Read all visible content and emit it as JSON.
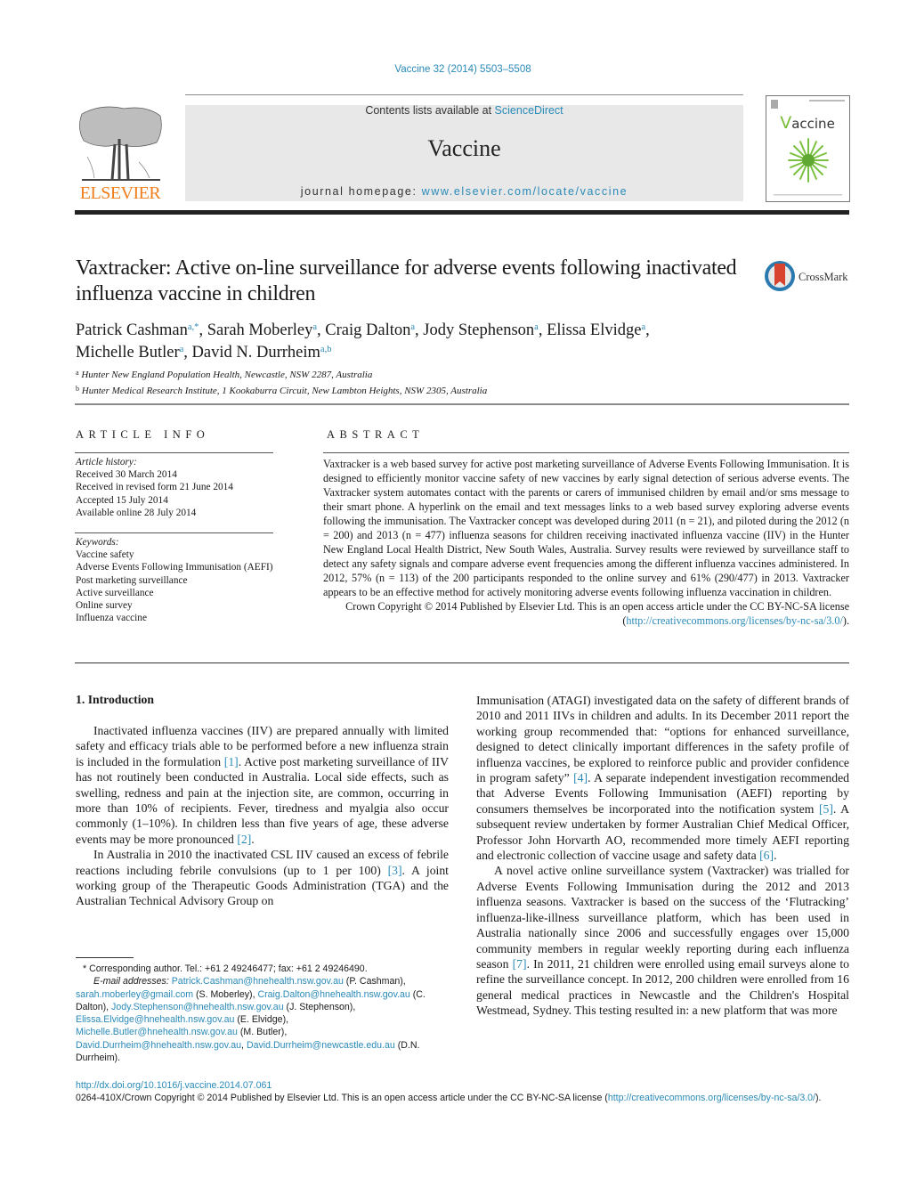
{
  "header": {
    "journal_ref": "Vaccine 32 (2014) 5503–5508",
    "contents_prefix": "Contents lists available at ",
    "contents_link": "ScienceDirect",
    "journal_title": "Vaccine",
    "homepage_prefix": "journal homepage: ",
    "homepage_link": "www.elsevier.com/locate/vaccine",
    "publisher_logo_text": "ELSEVIER",
    "cover_title": "Vaccine",
    "crossmark_label": "CrossMark"
  },
  "article": {
    "title": "Vaxtracker: Active on-line surveillance for adverse events following inactivated influenza vaccine in children",
    "authors": [
      {
        "name": "Patrick Cashman",
        "sup": "a,*"
      },
      {
        "name": "Sarah Moberley",
        "sup": "a"
      },
      {
        "name": "Craig Dalton",
        "sup": "a"
      },
      {
        "name": "Jody Stephenson",
        "sup": "a"
      },
      {
        "name": "Elissa Elvidge",
        "sup": "a"
      },
      {
        "name": "Michelle Butler",
        "sup": "a"
      },
      {
        "name": "David N. Durrheim",
        "sup": "a,b"
      }
    ],
    "affiliations": [
      {
        "key": "a",
        "text": "Hunter New England Population Health, Newcastle, NSW 2287, Australia"
      },
      {
        "key": "b",
        "text": "Hunter Medical Research Institute, 1 Kookaburra Circuit, New Lambton Heights, NSW 2305, Australia"
      }
    ]
  },
  "article_info": {
    "heading": "ARTICLE INFO",
    "history_label": "Article history:",
    "history": [
      "Received 30 March 2014",
      "Received in revised form 21 June 2014",
      "Accepted 15 July 2014",
      "Available online 28 July 2014"
    ],
    "keywords_label": "Keywords:",
    "keywords": [
      "Vaccine safety",
      "Adverse Events Following Immunisation (AEFI)",
      "Post marketing surveillance",
      "Active surveillance",
      "Online survey",
      "Influenza vaccine"
    ]
  },
  "abstract": {
    "heading": "ABSTRACT",
    "text": "Vaxtracker is a web based survey for active post marketing surveillance of Adverse Events Following Immunisation. It is designed to efficiently monitor vaccine safety of new vaccines by early signal detection of serious adverse events. The Vaxtracker system automates contact with the parents or carers of immunised children by email and/or sms message to their smart phone. A hyperlink on the email and text messages links to a web based survey exploring adverse events following the immunisation. The Vaxtracker concept was developed during 2011 (n = 21), and piloted during the 2012 (n = 200) and 2013 (n = 477) influenza seasons for children receiving inactivated influenza vaccine (IIV) in the Hunter New England Local Health District, New South Wales, Australia. Survey results were reviewed by surveillance staff to detect any safety signals and compare adverse event frequencies among the different influenza vaccines administered. In 2012, 57% (n = 113) of the 200 participants responded to the online survey and 61% (290/477) in 2013. Vaxtracker appears to be an effective method for actively monitoring adverse events following influenza vaccination in children.",
    "copyright_text": "Crown Copyright © 2014 Published by Elsevier Ltd. This is an open access article under the CC BY-NC-SA license (",
    "copyright_link": "http://creativecommons.org/licenses/by-nc-sa/3.0/",
    "copyright_end": ")."
  },
  "body": {
    "section_heading": "1.  Introduction",
    "left_paragraphs": [
      {
        "parts": [
          "Inactivated influenza vaccines (IIV) are prepared annually with limited safety and efficacy trials able to be performed before a new influenza strain is included in the formulation ",
          "[1]",
          ". Active post marketing surveillance of IIV has not routinely been conducted in Australia. Local side effects, such as swelling, redness and pain at the injection site, are common, occurring in more than 10% of recipients. Fever, tiredness and myalgia also occur commonly (1–10%). In children less than five years of age, these adverse events may be more pronounced ",
          "[2]",
          "."
        ]
      },
      {
        "parts": [
          "In Australia in 2010 the inactivated CSL IIV caused an excess of febrile reactions including febrile convulsions (up to 1 per 100) ",
          "[3]",
          ". A joint working group of the Therapeutic Goods Administration (TGA) and the Australian Technical Advisory Group on",
          "",
          ""
        ]
      }
    ],
    "right_paragraphs": [
      {
        "parts": [
          "Immunisation (ATAGI) investigated data on the safety of different brands of 2010 and 2011 IIVs in children and adults. In its December 2011 report the working group recommended that: “options for enhanced surveillance, designed to detect clinically important differences in the safety profile of influenza vaccines, be explored to reinforce public and provider confidence in program safety” ",
          "[4]",
          ". A separate independent investigation recommended that Adverse Events Following Immunisation (AEFI) reporting by consumers themselves be incorporated into the notification system ",
          "[5]",
          ". A subsequent review undertaken by former Australian Chief Medical Officer, Professor John Horvarth AO, recommended more timely AEFI reporting and electronic collection of vaccine usage and safety data ",
          "[6]",
          "."
        ]
      },
      {
        "parts": [
          "A novel active online surveillance system (Vaxtracker) was trialled for Adverse Events Following Immunisation during the 2012 and 2013 influenza seasons. Vaxtracker is based on the success of the ‘Flutracking’ influenza-like-illness surveillance platform, which has been used in Australia nationally since 2006 and successfully engages over 15,000 community members in regular weekly reporting during each influenza season ",
          "[7]",
          ". In 2011, 21 children were enrolled using email surveys alone to refine the surveillance concept. In 2012, 200 children were enrolled from 16 general medical practices in Newcastle and the Children's Hospital Westmead, Sydney. This testing resulted in: a new platform that was more"
        ]
      }
    ]
  },
  "footnotes": {
    "corresponding": "* Corresponding author. Tel.: +61 2 49246477; fax: +61 2 49246490.",
    "email_label": "E-mail addresses:",
    "emails": [
      {
        "address": "Patrick.Cashman@hnehealth.nsw.gov.au",
        "who": " (P. Cashman),"
      },
      {
        "address": "sarah.moberley@gmail.com",
        "who": " (S. Moberley),"
      },
      {
        "address": "Craig.Dalton@hnehealth.nsw.gov.au",
        "who": " (C. Dalton),"
      },
      {
        "address": "Jody.Stephenson@hnehealth.nsw.gov.au",
        "who": " (J. Stephenson),"
      },
      {
        "address": "Elissa.Elvidge@hnehealth.nsw.gov.au",
        "who": " (E. Elvidge),"
      },
      {
        "address": "Michelle.Butler@hnehealth.nsw.gov.au",
        "who": " (M. Butler),"
      },
      {
        "address": "David.Durrheim@hnehealth.nsw.gov.au",
        "who": ","
      },
      {
        "address": "David.Durrheim@newcastle.edu.au",
        "who": " (D.N. Durrheim)."
      }
    ]
  },
  "doi": {
    "link": "http://dx.doi.org/10.1016/j.vaccine.2014.07.061",
    "license_text": "0264-410X/Crown Copyright © 2014 Published by Elsevier Ltd. This is an open access article under the CC BY-NC-SA license (",
    "license_link": "http://creativecommons.org/licenses/by-nc-sa/3.0/",
    "license_end": ")."
  },
  "colors": {
    "link": "#2a8ab8",
    "elsevier_orange": "#f07e1c",
    "masthead_bg": "#e8e8e8"
  }
}
